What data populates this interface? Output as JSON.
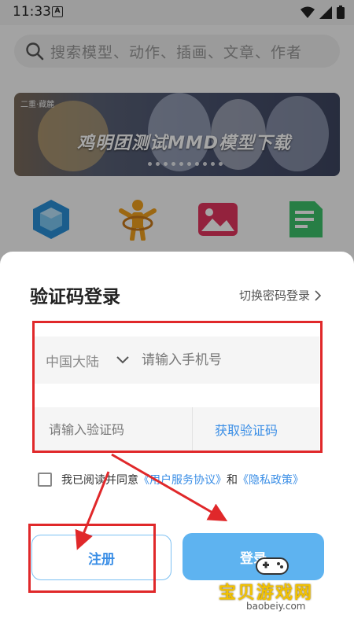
{
  "status_bar": {
    "time": "11:33",
    "badge": "A"
  },
  "background": {
    "search_placeholder": "搜索模型、动作、插画、文章、作者",
    "banner": {
      "tag": "二重·藏麓",
      "title": "鸡明团测试MMD模型下载"
    }
  },
  "login_sheet": {
    "title": "验证码登录",
    "switch_link": "切换密码登录",
    "region": "中国大陆",
    "phone_placeholder": "请输入手机号",
    "code_placeholder": "请输入验证码",
    "get_code": "获取验证码",
    "agreement": {
      "prefix": "我已阅读并同意",
      "terms": "《用户服务协议》",
      "and": "和",
      "privacy": "《隐私政策》"
    },
    "register_label": "注册",
    "login_label": "登录"
  },
  "watermark": {
    "text": "宝贝游戏网",
    "url": "baobeiy.com"
  },
  "colors": {
    "accent": "#3a8ee6",
    "login_bg": "#5eb3f0",
    "annotation_red": "#e0282a"
  }
}
